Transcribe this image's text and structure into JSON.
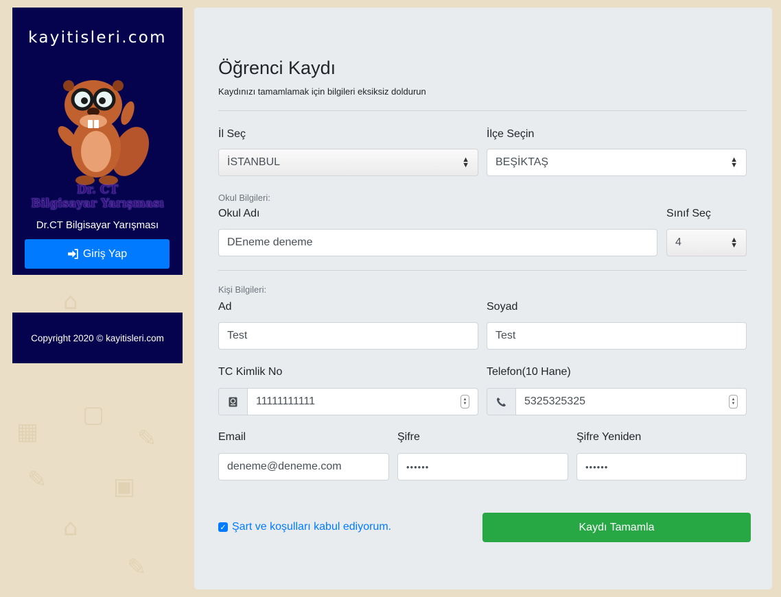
{
  "sidebar": {
    "brand": "kayitisleri.com",
    "logo_line1": "Dr. CT",
    "logo_line2": "Bilgisayar Yarışması",
    "subtitle": "Dr.CT Bilgisayar Yarışması",
    "login_label": "Giriş Yap"
  },
  "footer": {
    "copyright": "Copyright 2020 © kayitisleri.com"
  },
  "form": {
    "title": "Öğrenci Kaydı",
    "subtitle": "Kaydınızı tamamlamak için bilgileri eksiksiz doldurun",
    "il_label": "İl Seç",
    "il_value": "İSTANBUL",
    "ilce_label": "İlçe Seçin",
    "ilce_value": "BEŞİKTAŞ",
    "school_section": "Okul Bilgileri:",
    "school_label": "Okul Adı",
    "school_value": "DEneme deneme",
    "grade_label": "Sınıf Seç",
    "grade_value": "4",
    "person_section": "Kişi Bilgileri:",
    "ad_label": "Ad",
    "ad_value": "Test",
    "soyad_label": "Soyad",
    "soyad_value": "Test",
    "tc_label": "TC Kimlik No",
    "tc_value": "11111111111",
    "phone_label": "Telefon(10 Hane)",
    "phone_value": "5325325325",
    "email_label": "Email",
    "email_value": "deneme@deneme.com",
    "password_label": "Şifre",
    "password_value": "••••••",
    "password2_label": "Şifre Yeniden",
    "password2_value": "••••••",
    "terms_label": "Şart ve koşulları kabul ediyorum.",
    "terms_checked": true,
    "submit_label": "Kaydı Tamamla"
  },
  "colors": {
    "background": "#eadfc6",
    "sidebar": "#05034d",
    "primary": "#007bff",
    "success": "#28a745"
  },
  "icons": [
    "sign-in-icon",
    "passport-icon",
    "phone-icon",
    "check-icon"
  ]
}
